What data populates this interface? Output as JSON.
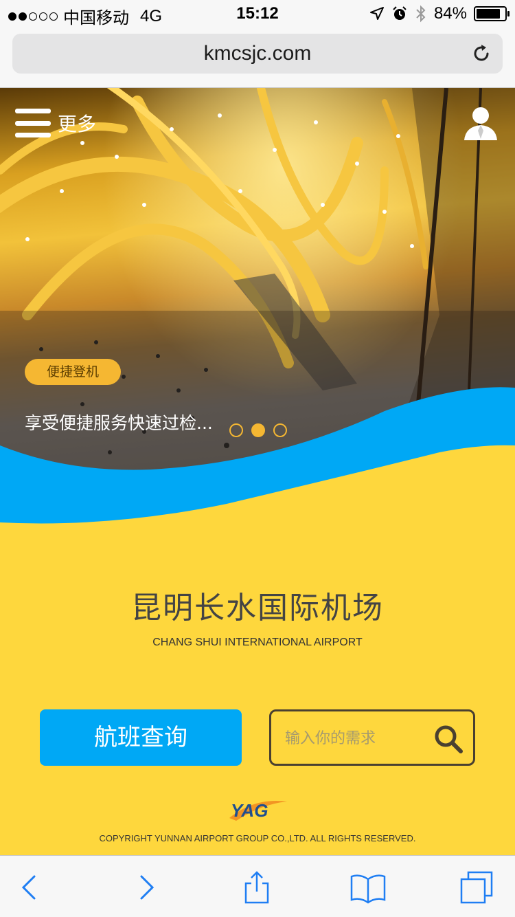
{
  "status_bar": {
    "carrier": "中国移动",
    "network": "4G",
    "time": "15:12",
    "battery_percent": "84%",
    "battery_level": 0.84,
    "signal_strength": 2
  },
  "browser": {
    "url": "kmcsjc.com"
  },
  "header": {
    "menu_label": "更多"
  },
  "hero": {
    "badge": "便捷登机",
    "caption": "享受便捷服务快速过检...",
    "slide_count": 3,
    "active_slide": 2
  },
  "main": {
    "airport_name": "昆明长水国际机场",
    "airport_name_en": "CHANG SHUI INTERNATIONAL AIRPORT",
    "flight_button_label": "航班查询",
    "search_placeholder": "输入你的需求",
    "logo_text": "YAG",
    "copyright": "COPYRIGHT YUNNAN AIRPORT GROUP CO.,LTD. ALL RIGHTS RESERVED."
  },
  "colors": {
    "main_background": "#fed73d",
    "accent_blue": "#00a8f5",
    "badge_orange": "#f5b732",
    "ios_blue": "#1f7ef3"
  },
  "icons": {
    "reload": "reload-icon",
    "menu": "hamburger-icon",
    "user": "user-icon",
    "search": "search-icon",
    "toolbar": [
      "back-icon",
      "forward-icon",
      "share-icon",
      "bookmarks-icon",
      "tabs-icon"
    ]
  }
}
